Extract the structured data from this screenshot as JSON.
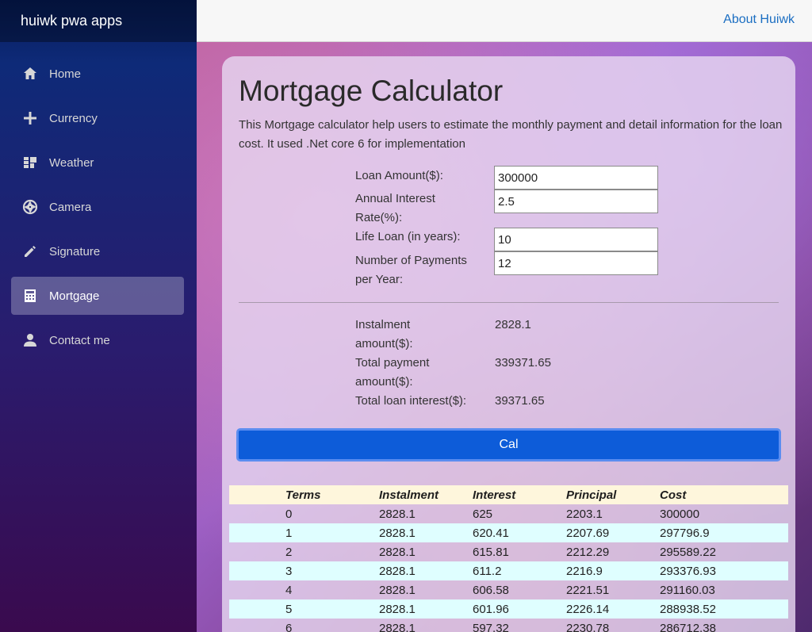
{
  "brand": "huiwk pwa apps",
  "topbar": {
    "about_link": "About Huiwk"
  },
  "sidebar": {
    "items": [
      {
        "label": "Home",
        "icon": "home-icon",
        "active": false
      },
      {
        "label": "Currency",
        "icon": "plus-icon",
        "active": false
      },
      {
        "label": "Weather",
        "icon": "dashboard-icon",
        "active": false
      },
      {
        "label": "Camera",
        "icon": "camera-aperture-icon",
        "active": false
      },
      {
        "label": "Signature",
        "icon": "pencil-icon",
        "active": false
      },
      {
        "label": "Mortgage",
        "icon": "calculator-icon",
        "active": true
      },
      {
        "label": "Contact me",
        "icon": "person-icon",
        "active": false
      }
    ]
  },
  "page": {
    "title": "Mortgage Calculator",
    "description": "This Mortgage calculator help users to estimate the monthly payment and detail information for the loan cost. It used .Net core 6 for implementation"
  },
  "form": {
    "loan_amount_label": "Loan Amount($):",
    "loan_amount_value": "300000",
    "interest_label": "Annual Interest Rate(%):",
    "interest_value": "2.5",
    "life_label": "Life Loan (in years):",
    "life_value": "10",
    "payments_label": "Number of Payments per Year:",
    "payments_value": "12"
  },
  "results": {
    "instalment_label": "Instalment amount($):",
    "instalment_value": "2828.1",
    "total_payment_label": "Total payment amount($):",
    "total_payment_value": "339371.65",
    "total_interest_label": "Total loan interest($):",
    "total_interest_value": "39371.65"
  },
  "cal_button": "Cal",
  "table": {
    "headers": [
      "Terms",
      "Instalment",
      "Interest",
      "Principal",
      "Cost"
    ],
    "rows": [
      [
        "0",
        "2828.1",
        "625",
        "2203.1",
        "300000"
      ],
      [
        "1",
        "2828.1",
        "620.41",
        "2207.69",
        "297796.9"
      ],
      [
        "2",
        "2828.1",
        "615.81",
        "2212.29",
        "295589.22"
      ],
      [
        "3",
        "2828.1",
        "611.2",
        "2216.9",
        "293376.93"
      ],
      [
        "4",
        "2828.1",
        "606.58",
        "2221.51",
        "291160.03"
      ],
      [
        "5",
        "2828.1",
        "601.96",
        "2226.14",
        "288938.52"
      ],
      [
        "6",
        "2828.1",
        "597.32",
        "2230.78",
        "286712.38"
      ]
    ]
  },
  "colors": {
    "accent": "#0d5cd9",
    "link": "#1b6ec2",
    "table_header_bg": "#fef6dc",
    "table_alt_row_bg": "#dffeff"
  }
}
